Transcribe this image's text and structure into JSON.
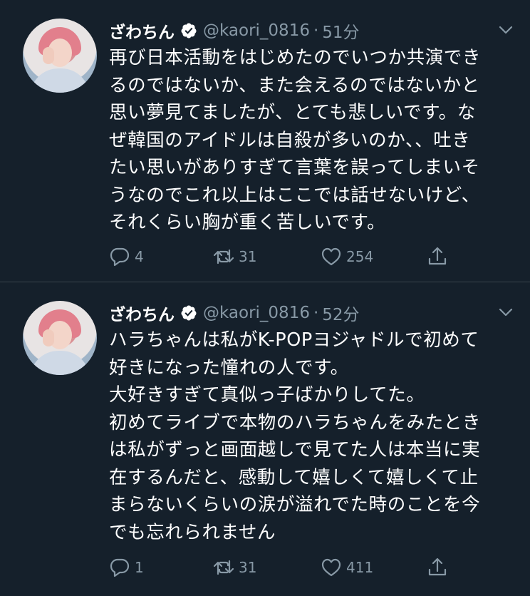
{
  "tweets": [
    {
      "name": "ざわちん",
      "handle": "@kaori_0816",
      "separator": "·",
      "time": "51分",
      "lines": [
        "再び日本活動をはじめたのでいつか共演でき",
        "るのではないか、また会えるのではないかと",
        "思い夢見てましたが、とても悲しいです。な",
        "ぜ韓国のアイドルは自殺が多いのか、、吐き",
        "たい思いがありすぎて言葉を誤ってしまいそ",
        "うなのでこれ以上はここでは話せないけど、",
        "それくらい胸が重く苦しいです。"
      ],
      "replies": "4",
      "retweets": "31",
      "likes": "254"
    },
    {
      "name": "ざわちん",
      "handle": "@kaori_0816",
      "separator": "·",
      "time": "52分",
      "lines": [
        "ハラちゃんは私がK-POPヨジャドルで初めて",
        "好きになった憧れの人です。",
        "大好きすぎて真似っ子ばかりしてた。",
        "初めてライブで本物のハラちゃんをみたとき",
        "は私がずっと画面越しで見てた人は本当に実",
        "在するんだと、感動して嬉しくて嬉しくて止",
        "まらないくらいの涙が溢れでた時のことを今",
        "でも忘れられません"
      ],
      "replies": "1",
      "retweets": "31",
      "likes": "411"
    }
  ],
  "icons": {
    "verified": "verified-badge-icon",
    "more": "chevron-down-icon",
    "reply": "reply-icon",
    "retweet": "retweet-icon",
    "like": "heart-icon",
    "share": "share-icon"
  },
  "colors": {
    "background": "#15202b",
    "text": "#ffffff",
    "secondary": "#8899a6",
    "divider": "#38444d"
  }
}
